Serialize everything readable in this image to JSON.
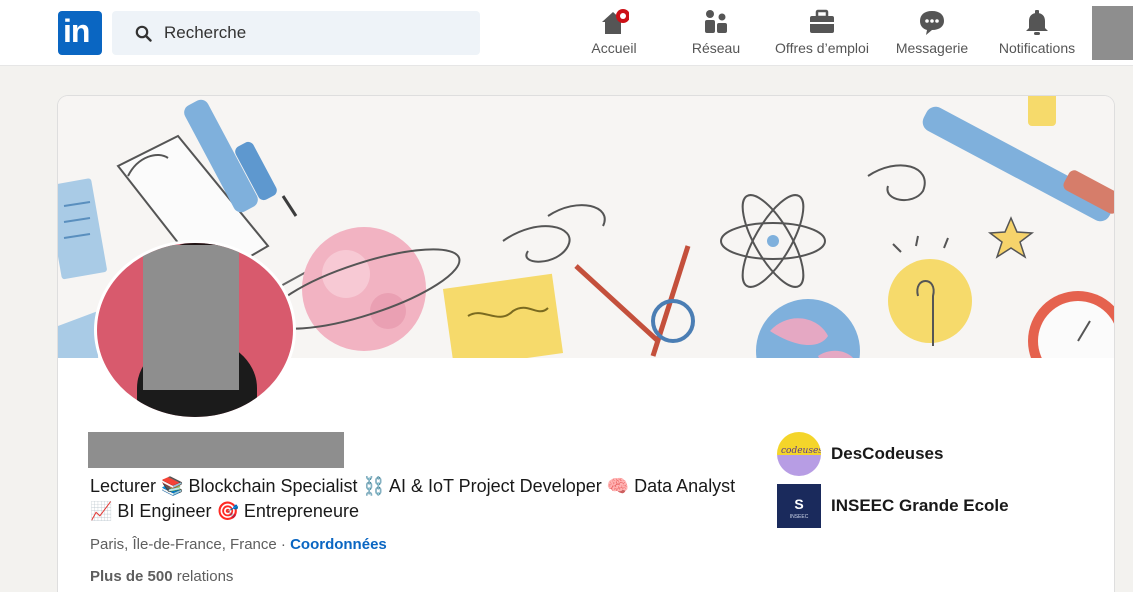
{
  "nav": {
    "logo_text": "in",
    "search_placeholder": "Recherche",
    "items": [
      {
        "label": "Accueil",
        "icon": "home-icon"
      },
      {
        "label": "Réseau",
        "icon": "network-icon"
      },
      {
        "label": "Offres d’emploi",
        "icon": "briefcase-icon"
      },
      {
        "label": "Messagerie",
        "icon": "messaging-icon"
      },
      {
        "label": "Notifications",
        "icon": "bell-icon"
      }
    ]
  },
  "profile": {
    "headline": "Lecturer 📚 Blockchain Specialist ⛓️ AI & IoT Project Developer 🧠 Data Analyst 📈 BI Engineer 🎯 Entrepreneure",
    "location": "Paris, Île-de-France, France",
    "separator": " · ",
    "contact_link": "Coordonnées",
    "relations_bold": "Plus de 500",
    "relations_rest": " relations"
  },
  "organizations": [
    {
      "name": "DesCodeuses",
      "logo_text": "codeuses"
    },
    {
      "name": "INSEEC Grande Ecole",
      "logo_text": "S",
      "logo_small": "INSEEC"
    }
  ],
  "colors": {
    "brand": "#0a66c2",
    "page_bg": "#f3f2ef",
    "avatar_bg": "#d85a6d",
    "notification_dot": "#cc1016",
    "redaction": "#8e8e8e"
  }
}
